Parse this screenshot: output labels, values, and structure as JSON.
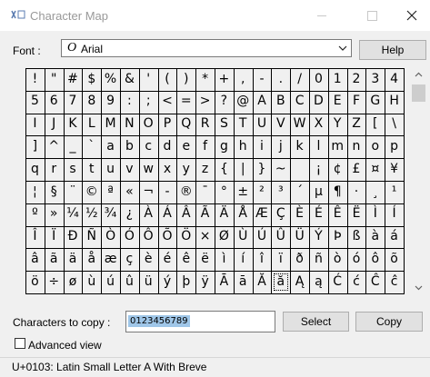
{
  "window": {
    "title": "Character Map"
  },
  "font": {
    "label": "Font :",
    "selected": "Arial"
  },
  "buttons": {
    "help": "Help",
    "select": "Select",
    "copy": "Copy"
  },
  "grid": {
    "selected_char": "ă",
    "rows": [
      [
        "!",
        "\"",
        "#",
        "$",
        "%",
        "&",
        "'",
        "(",
        ")",
        "*",
        "+",
        ",",
        "-",
        ".",
        "/",
        "0",
        "1",
        "2",
        "3",
        "4"
      ],
      [
        "5",
        "6",
        "7",
        "8",
        "9",
        ":",
        ";",
        "<",
        "=",
        ">",
        "?",
        "@",
        "A",
        "B",
        "C",
        "D",
        "E",
        "F",
        "G",
        "H"
      ],
      [
        "I",
        "J",
        "K",
        "L",
        "M",
        "N",
        "O",
        "P",
        "Q",
        "R",
        "S",
        "T",
        "U",
        "V",
        "W",
        "X",
        "Y",
        "Z",
        "[",
        "\\"
      ],
      [
        "]",
        "^",
        "_",
        "`",
        "a",
        "b",
        "c",
        "d",
        "e",
        "f",
        "g",
        "h",
        "i",
        "j",
        "k",
        "l",
        "m",
        "n",
        "o",
        "p"
      ],
      [
        "q",
        "r",
        "s",
        "t",
        "u",
        "v",
        "w",
        "x",
        "y",
        "z",
        "{",
        "|",
        "}",
        "~",
        " ",
        "¡",
        "¢",
        "£",
        "¤",
        "¥"
      ],
      [
        "¦",
        "§",
        "¨",
        "©",
        "ª",
        "«",
        "¬",
        "-",
        "®",
        "¯",
        "°",
        "±",
        "²",
        "³",
        "´",
        "µ",
        "¶",
        "·",
        "¸",
        "¹"
      ],
      [
        "º",
        "»",
        "¼",
        "½",
        "¾",
        "¿",
        "À",
        "Á",
        "Â",
        "Ã",
        "Ä",
        "Å",
        "Æ",
        "Ç",
        "È",
        "É",
        "Ê",
        "Ë",
        "Ì",
        "Í"
      ],
      [
        "Î",
        "Ï",
        "Ð",
        "Ñ",
        "Ò",
        "Ó",
        "Ô",
        "Õ",
        "Ö",
        "×",
        "Ø",
        "Ù",
        "Ú",
        "Û",
        "Ü",
        "Ý",
        "Þ",
        "ß",
        "à",
        "á"
      ],
      [
        "â",
        "ã",
        "ä",
        "å",
        "æ",
        "ç",
        "è",
        "é",
        "ê",
        "ë",
        "ì",
        "í",
        "î",
        "ï",
        "ð",
        "ñ",
        "ò",
        "ó",
        "ô",
        "õ"
      ],
      [
        "ö",
        "÷",
        "ø",
        "ù",
        "ú",
        "û",
        "ü",
        "ý",
        "þ",
        "ÿ",
        "Ā",
        "ā",
        "Ă",
        "ă",
        "Ą",
        "ą",
        "Ć",
        "ć",
        "Ĉ",
        "ĉ"
      ]
    ]
  },
  "copy": {
    "label": "Characters to copy :",
    "value": "0123456789"
  },
  "advanced": {
    "label": "Advanced view",
    "checked": false
  },
  "status": {
    "text": "U+0103: Latin Small Letter A With Breve"
  },
  "colors": {
    "selection": "#9fc6e8",
    "button_bg": "#e1e1e1",
    "window_bg": "#f0f0f0"
  }
}
